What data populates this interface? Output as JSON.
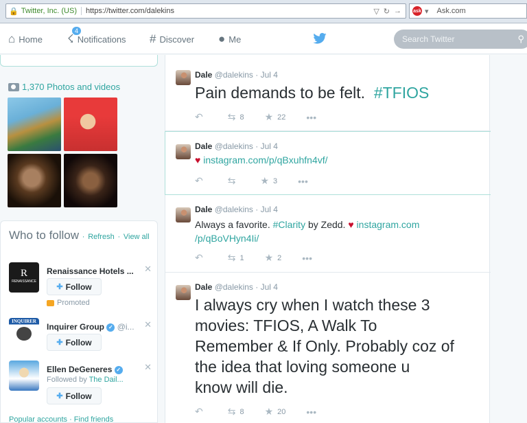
{
  "browser": {
    "site_identity": "Twitter, Inc. (US)",
    "url": "https://twitter.com/dalekins",
    "search_engine": "Ask.com",
    "search_logo_text": "ask"
  },
  "nav": {
    "home": "Home",
    "notifications": "Notifications",
    "notifications_badge": "4",
    "discover": "Discover",
    "me": "Me",
    "search_placeholder": "Search Twitter"
  },
  "photos": {
    "link_label": "1,370 Photos and videos"
  },
  "who_to_follow": {
    "title": "Who to follow",
    "refresh": "Refresh",
    "separator": "·",
    "view_all": "View all",
    "follow_label": "Follow",
    "accounts": [
      {
        "name": "Renaissance Hotels ...",
        "sub": "Promoted",
        "logo_letter": "R",
        "logo_text": "RENAISSANCE"
      },
      {
        "name": "Inquirer Group",
        "handle": "@i...",
        "logo_text": "INQUIRER"
      },
      {
        "name": "Ellen DeGeneres",
        "sub_prefix": "Followed by",
        "sub_link": "The Dail..."
      }
    ],
    "footer_popular": "Popular accounts",
    "footer_find": "Find friends"
  },
  "tweets": [
    {
      "name": "Dale",
      "handle": "@dalekins",
      "time": "Jul 4",
      "text": "Pain demands to be felt.",
      "hashtag": "#TFIOS",
      "retweets": "8",
      "favorites": "22"
    },
    {
      "name": "Dale",
      "handle": "@dalekins",
      "time": "Jul 4",
      "heart": "♥",
      "link": "instagram.com/p/qBxuhfn4vf/",
      "retweets": "",
      "favorites": "3"
    },
    {
      "name": "Dale",
      "handle": "@dalekins",
      "time": "Jul 4",
      "text_a": "Always a favorite.",
      "hashtag": "#Clarity",
      "text_b": "by Zedd.",
      "heart": "♥",
      "link_a": "instagram.com",
      "link_b": "/p/qBoVHyn4Ii/",
      "retweets": "1",
      "favorites": "2"
    },
    {
      "name": "Dale",
      "handle": "@dalekins",
      "time": "Jul 4",
      "lines": [
        "I always cry when I watch these 3",
        "movies: TFIOS, A Walk To",
        "Remember & If Only. Probably coz of",
        "the idea that loving someone u",
        "know will die."
      ],
      "retweets": "8",
      "favorites": "20"
    }
  ],
  "colors": {
    "accent": "#2fa5a0",
    "twitter_blue": "#55acee",
    "heart": "#c8102e"
  }
}
